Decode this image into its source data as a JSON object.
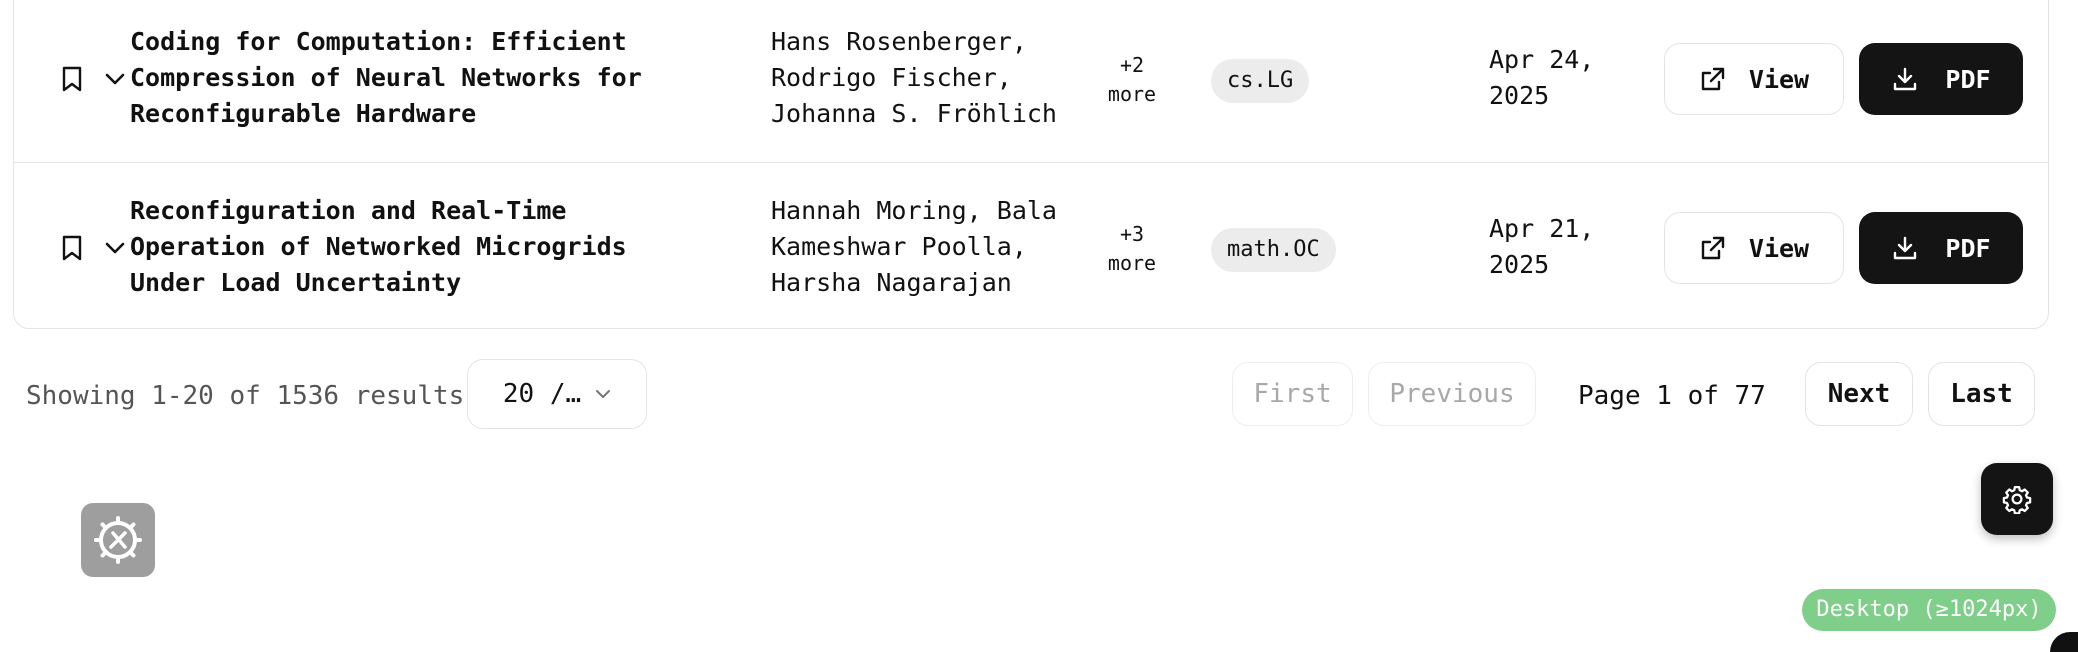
{
  "rows": [
    {
      "title_lines": [
        "Coding for Computation: Efficient",
        "Compression of Neural Networks for",
        "Reconfigurable Hardware"
      ],
      "author_lines": [
        "Hans Rosenberger,",
        "Rodrigo Fischer,",
        "Johanna S. Fröhlich"
      ],
      "more": [
        "+2",
        "more"
      ],
      "category": "cs.LG",
      "date_lines": [
        "Apr 24,",
        "2025"
      ],
      "view_label": "View",
      "pdf_label": "PDF"
    },
    {
      "title_lines": [
        "Reconfiguration and Real-Time",
        "Operation of Networked Microgrids",
        "Under Load Uncertainty"
      ],
      "author_lines": [
        "Hannah Moring, Bala",
        "Kameshwar Poolla,",
        "Harsha Nagarajan"
      ],
      "more": [
        "+3",
        "more"
      ],
      "category": "math.OC",
      "date_lines": [
        "Apr 21,",
        "2025"
      ],
      "view_label": "View",
      "pdf_label": "PDF"
    }
  ],
  "pagination": {
    "showing": "Showing 1-20 of 1536 results",
    "per_page": "20 /…",
    "first": "First",
    "previous": "Previous",
    "page_label": "Page 1 of 77",
    "next": "Next",
    "last": "Last"
  },
  "viewport_badge": "Desktop (≥1024px)",
  "icons": {
    "bookmark": "bookmark-icon",
    "expand": "chevron-down-icon",
    "external": "external-link-icon",
    "download": "download-icon",
    "settings": "gear-icon",
    "tools": "tools-icon"
  },
  "colors": {
    "primary_button": "#141414",
    "badge_bg": "#ececec",
    "viewport_badge": "#7fcf8a",
    "border": "#e4e4e7"
  }
}
